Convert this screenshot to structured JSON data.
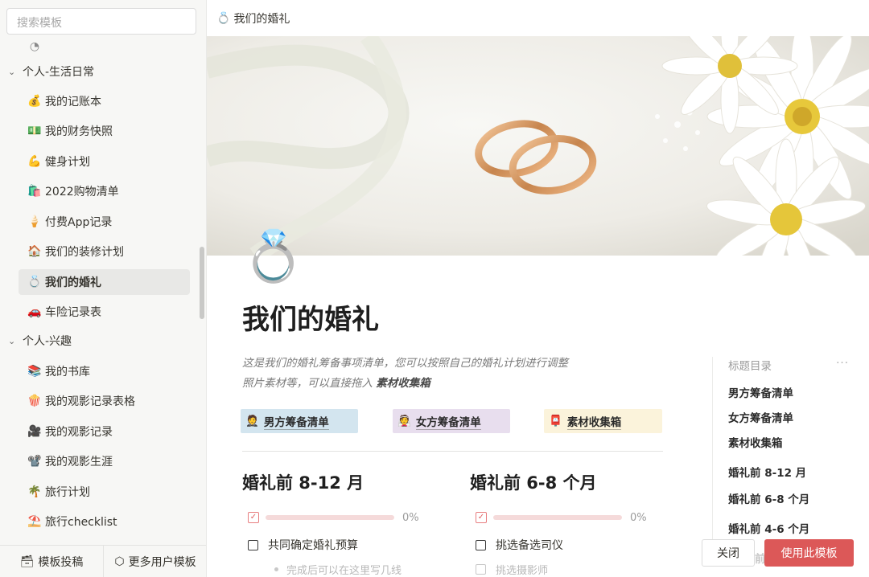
{
  "sidebar": {
    "search_placeholder": "搜索模板",
    "groups": [
      {
        "label": "个人-生活日常",
        "items": [
          {
            "icon": "💰",
            "label": "我的记账本"
          },
          {
            "icon": "💵",
            "label": "我的财务快照"
          },
          {
            "icon": "💪",
            "label": "健身计划"
          },
          {
            "icon": "🛍️",
            "label": "2022购物清单"
          },
          {
            "icon": "🍦",
            "label": "付费App记录"
          },
          {
            "icon": "🏠",
            "label": "我们的装修计划"
          },
          {
            "icon": "💍",
            "label": "我们的婚礼"
          },
          {
            "icon": "🚗",
            "label": "车险记录表"
          }
        ]
      },
      {
        "label": "个人-兴趣",
        "items": [
          {
            "icon": "📚",
            "label": "我的书库"
          },
          {
            "icon": "🍿",
            "label": "我的观影记录表格"
          },
          {
            "icon": "🎥",
            "label": "我的观影记录"
          },
          {
            "icon": "📽️",
            "label": "我的观影生涯"
          },
          {
            "icon": "🌴",
            "label": "旅行计划"
          },
          {
            "icon": "⛱️",
            "label": "旅行checklist"
          }
        ]
      }
    ],
    "bottom": {
      "submit_label": "模板投稿",
      "more_label": "更多用户模板"
    }
  },
  "topbar": {
    "icon": "💍",
    "title": "我们的婚礼"
  },
  "page": {
    "icon": "💍",
    "title": "我们的婚礼",
    "desc_line1": "这是我们的婚礼筹备事项清单，您可以按照自己的婚礼计划进行调整",
    "desc_line2_prefix": "照片素材等，可以直接拖入 ",
    "desc_line2_bold": "素材收集箱",
    "links": [
      {
        "icon": "🤵",
        "label": "男方筹备清单",
        "color": "#d3e5ef"
      },
      {
        "icon": "👰",
        "label": "女方筹备清单",
        "color": "#e8deee"
      },
      {
        "icon": "📮",
        "label": "素材收集箱",
        "color": "#fbf3db"
      }
    ],
    "sections": [
      {
        "heading": "婚礼前 8-12 月",
        "progress": 0,
        "progress_label": "0%",
        "todo": "共同确定婚礼预算",
        "sub": "完成后可以在这里写几线"
      },
      {
        "heading": "婚礼前 6-8 个月",
        "progress": 0,
        "progress_label": "0%",
        "todo": "挑选备选司仪",
        "sub": "挑选摄影师"
      }
    ]
  },
  "toc": {
    "title": "标题目录",
    "more": "···",
    "items": [
      "男方筹备清单",
      "女方筹备清单",
      "素材收集箱",
      "婚礼前 8-12 月",
      "婚礼前 6-8 个月",
      "婚礼前 4-6 个月"
    ],
    "partial": "前"
  },
  "actions": {
    "close_label": "关闭",
    "use_label": "使用此模板"
  },
  "colors": {
    "accent": "#dc5858",
    "sidebar_bg": "#f7f7f5"
  }
}
